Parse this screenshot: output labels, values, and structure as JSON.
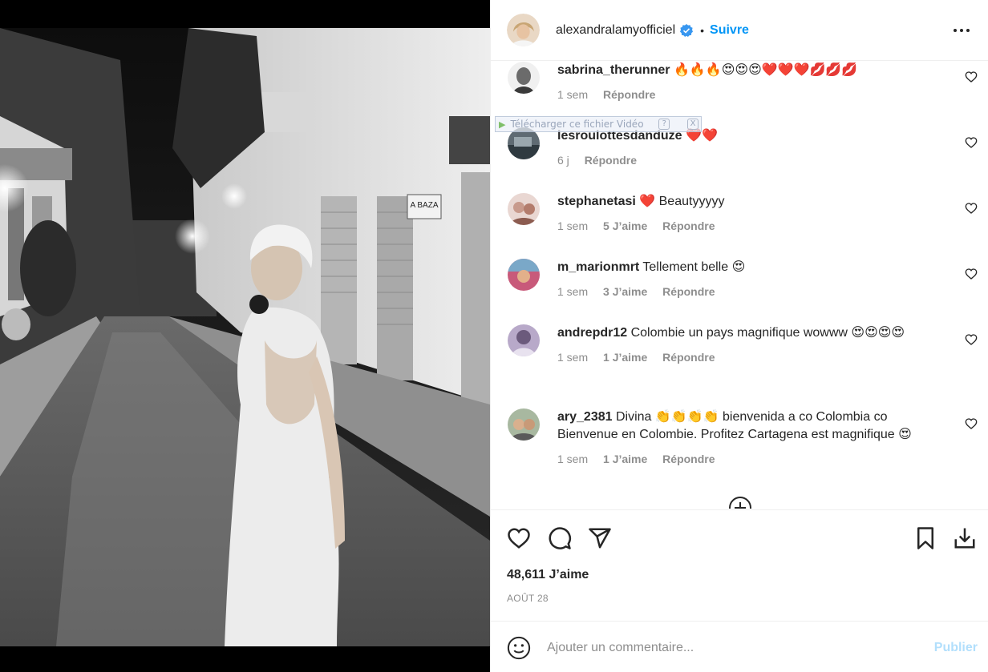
{
  "post": {
    "username": "alexandralamyofficiel",
    "header_dot": "•",
    "follow_label": "Suivre",
    "likes": "48,611 J’aime",
    "date": "AOÛT 28",
    "comment_placeholder": "Ajouter un commentaire...",
    "publish_label": "Publier"
  },
  "download_widget": {
    "label": "Télécharger ce fichier Vidéo",
    "help": "?",
    "close": "X"
  },
  "comments": [
    {
      "username": "sabrina_therunner",
      "text": "🔥🔥🔥😍😍😍❤️❤️❤️💋💋💋",
      "time": "1 sem",
      "likes": "",
      "reply": "Répondre"
    },
    {
      "username": "lesroulottesdanduze",
      "text": "❤️❤️",
      "time": "6 j",
      "likes": "",
      "reply": "Répondre"
    },
    {
      "username": "stephanetasi",
      "text": "❤️ Beautyyyyy",
      "time": "1 sem",
      "likes": "5 J’aime",
      "reply": "Répondre"
    },
    {
      "username": "m_marionmrt",
      "text": "Tellement belle 😍",
      "time": "1 sem",
      "likes": "3 J’aime",
      "reply": "Répondre"
    },
    {
      "username": "andrepdr12",
      "text": "Colombie un pays magnifique wowww 😍😍😍😍",
      "time": "1 sem",
      "likes": "1 J’aime",
      "reply": "Répondre"
    },
    {
      "username": "ary_2381",
      "text": "Divina 👏👏👏👏 bienvenida a co Colombia co Bienvenue en Colombie. Profitez Cartagena est magnifique 😍",
      "time": "1 sem",
      "likes": "1 J’aime",
      "reply": "Répondre"
    }
  ],
  "photo_sign": "A BAZA",
  "colors": {
    "accent": "#0095f6",
    "publish_disabled": "#b2dffc",
    "muted": "#8e8e8e",
    "text": "#262626",
    "border": "#efefef"
  }
}
